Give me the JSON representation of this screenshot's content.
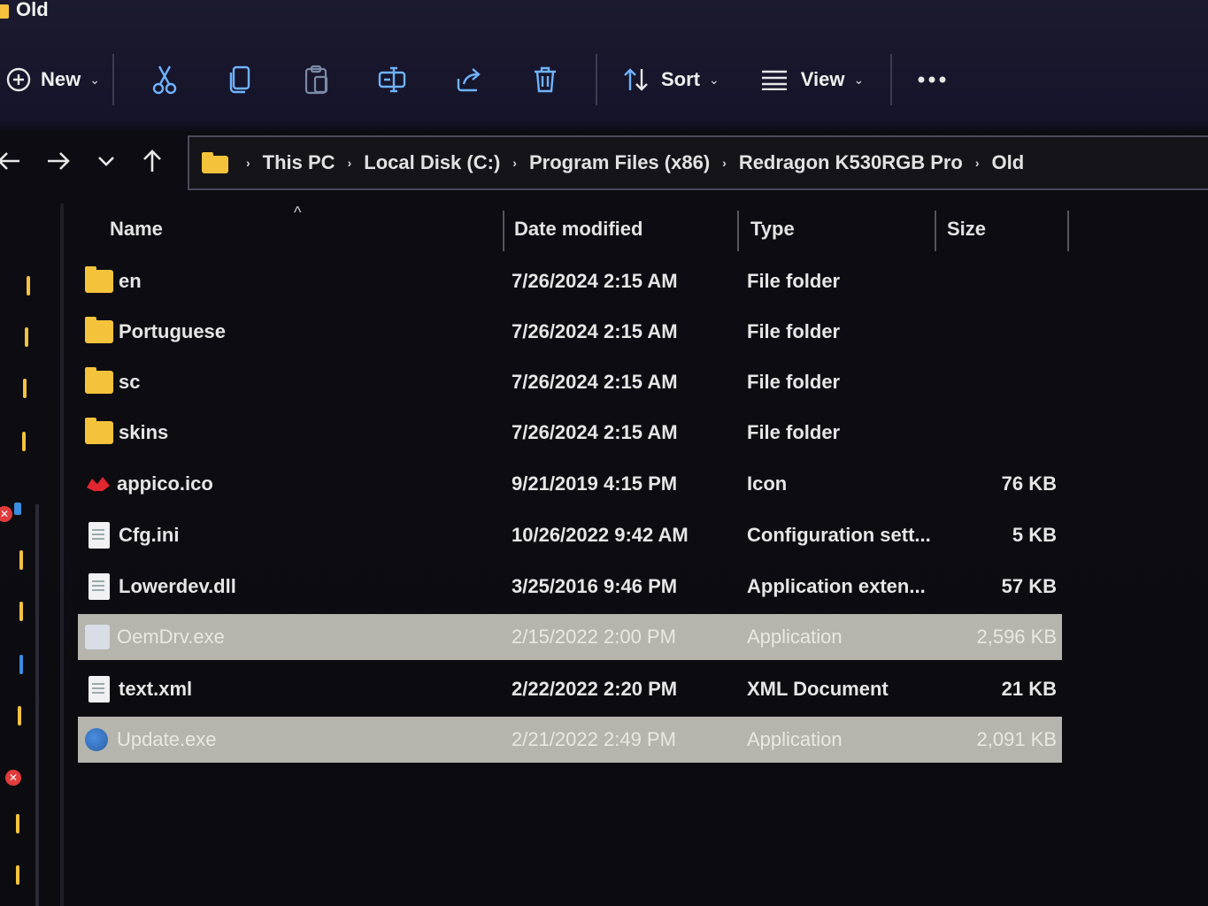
{
  "window": {
    "title": "Old"
  },
  "toolbar": {
    "new_label": "New",
    "sort_label": "Sort",
    "view_label": "View",
    "icons": [
      "cut-icon",
      "copy-icon",
      "paste-icon",
      "rename-icon",
      "share-icon",
      "delete-icon"
    ]
  },
  "breadcrumb": {
    "items": [
      "This PC",
      "Local Disk (C:)",
      "Program Files (x86)",
      "Redragon K530RGB Pro",
      "Old"
    ]
  },
  "columns": {
    "name": "Name",
    "date": "Date modified",
    "type": "Type",
    "size": "Size"
  },
  "files": [
    {
      "name": "en",
      "date": "7/26/2024 2:15 AM",
      "type": "File folder",
      "size": "",
      "kind": "folder",
      "selected": false
    },
    {
      "name": "Portuguese",
      "date": "7/26/2024 2:15 AM",
      "type": "File folder",
      "size": "",
      "kind": "folder",
      "selected": false
    },
    {
      "name": "sc",
      "date": "7/26/2024 2:15 AM",
      "type": "File folder",
      "size": "",
      "kind": "folder",
      "selected": false
    },
    {
      "name": "skins",
      "date": "7/26/2024 2:15 AM",
      "type": "File folder",
      "size": "",
      "kind": "folder",
      "selected": false
    },
    {
      "name": "appico.ico",
      "date": "9/21/2019 4:15 PM",
      "type": "Icon",
      "size": "76 KB",
      "kind": "ico",
      "selected": false
    },
    {
      "name": "Cfg.ini",
      "date": "10/26/2022 9:42 AM",
      "type": "Configuration sett...",
      "size": "5 KB",
      "kind": "doc",
      "selected": false
    },
    {
      "name": "Lowerdev.dll",
      "date": "3/25/2016 9:46 PM",
      "type": "Application exten...",
      "size": "57 KB",
      "kind": "doc",
      "selected": false
    },
    {
      "name": "OemDrv.exe",
      "date": "2/15/2022 2:00 PM",
      "type": "Application",
      "size": "2,596 KB",
      "kind": "exe",
      "selected": true
    },
    {
      "name": "text.xml",
      "date": "2/22/2022 2:20 PM",
      "type": "XML Document",
      "size": "21 KB",
      "kind": "doc",
      "selected": false
    },
    {
      "name": "Update.exe",
      "date": "2/21/2022 2:49 PM",
      "type": "Application",
      "size": "2,091 KB",
      "kind": "update",
      "selected": true
    }
  ],
  "colors": {
    "accent_folder": "#f5c33b",
    "selection": "#b5b5ae",
    "background": "#0b0b10"
  }
}
